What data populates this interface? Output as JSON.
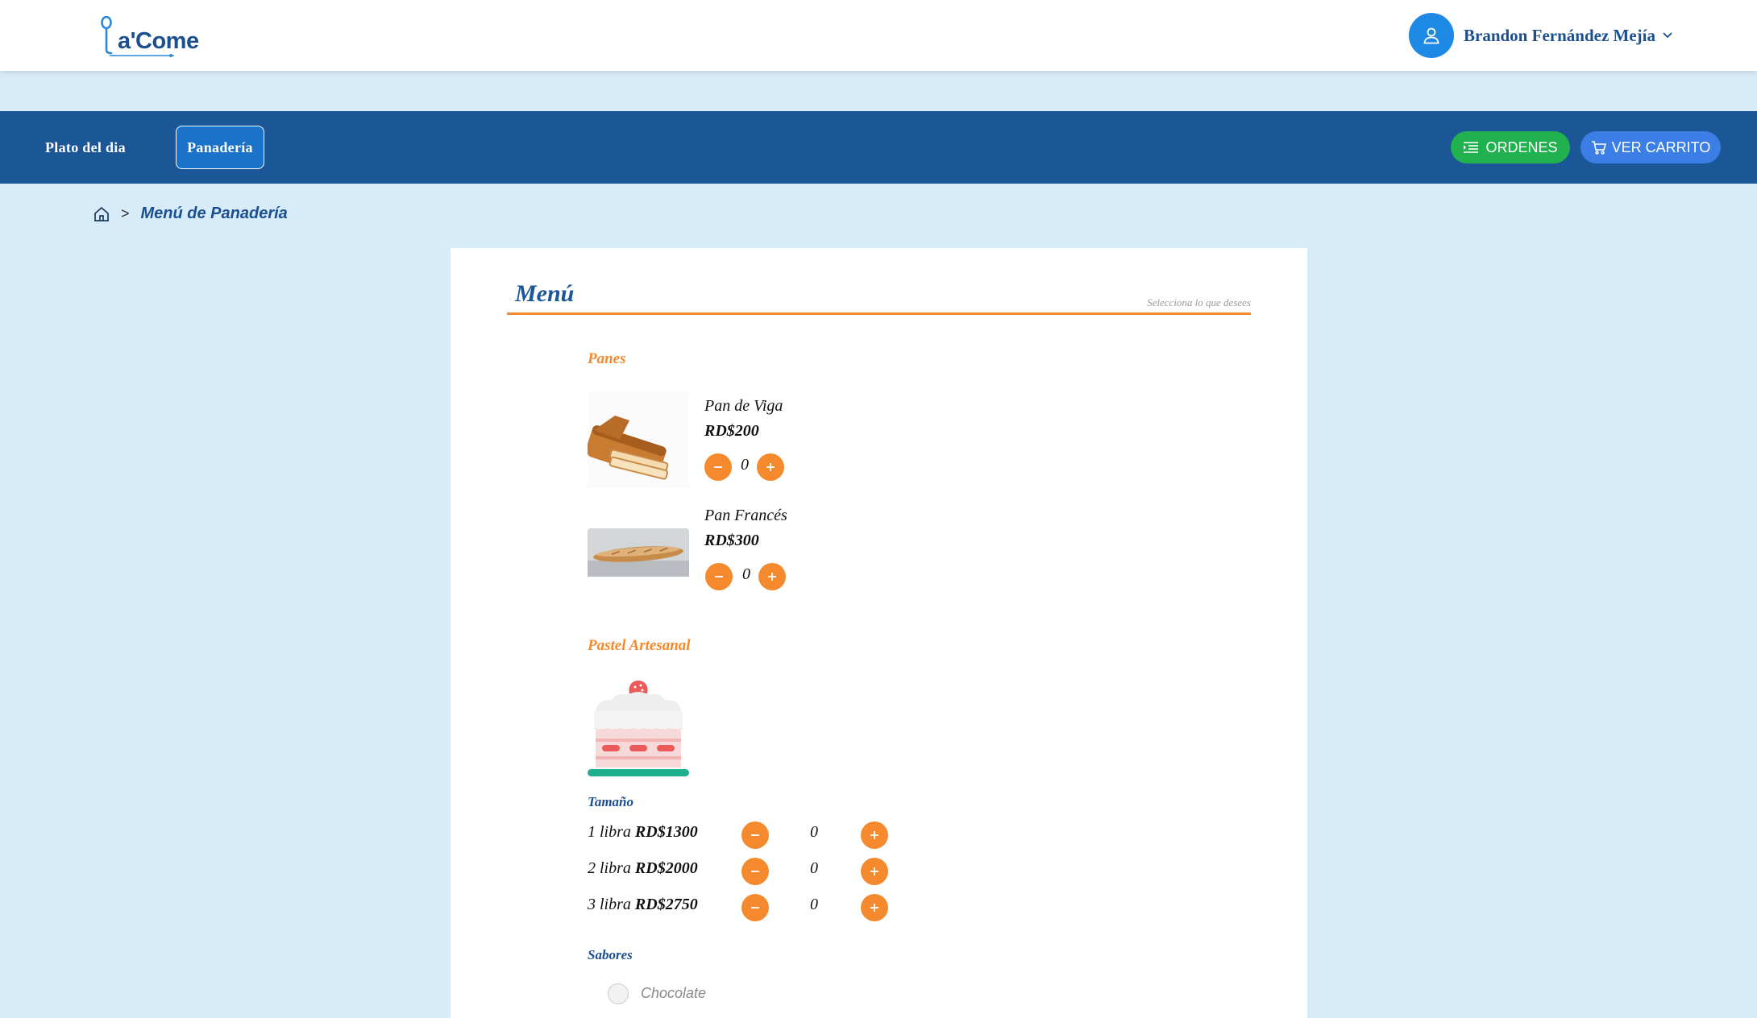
{
  "header": {
    "logo_text": "a'Come",
    "user_name": "Brandon Fernández Mejía"
  },
  "nav": {
    "links": [
      "Plato del dia",
      "Panadería"
    ],
    "active": "Panadería",
    "orders_label": "ORDENES",
    "cart_label": "VER CARRITO"
  },
  "breadcrumb": {
    "separator": ">",
    "current": "Menú de Panadería"
  },
  "menu": {
    "title": "Menú",
    "subtitle": "Selecciona lo que desees",
    "sections": {
      "panes": {
        "title": "Panes",
        "items": [
          {
            "name": "Pan de Viga",
            "price": "RD$200",
            "qty": "0"
          },
          {
            "name": "Pan Francés",
            "price": "RD$300",
            "qty": "0"
          }
        ]
      },
      "pastel": {
        "title": "Pastel Artesanal",
        "size_label": "Tamaño",
        "sizes": [
          {
            "name": "1 libra",
            "price": "RD$1300",
            "qty": "0"
          },
          {
            "name": "2 libra",
            "price": "RD$2000",
            "qty": "0"
          },
          {
            "name": "3 libra",
            "price": "RD$2750",
            "qty": "0"
          }
        ],
        "flavors_label": "Sabores",
        "flavors": [
          "Chocolate"
        ]
      }
    }
  },
  "colors": {
    "primary": "#1b5697",
    "accent": "#f5892d",
    "background": "#d8ebf9",
    "orders_button": "#21b24f",
    "cart_button": "#3b7fe6"
  },
  "icons": [
    "spoon-icon",
    "user-icon",
    "chevron-down-icon",
    "list-icon",
    "cart-icon",
    "home-icon",
    "minus-icon",
    "plus-icon"
  ]
}
